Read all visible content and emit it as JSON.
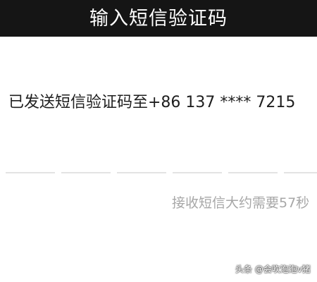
{
  "header": {
    "title": "输入短信验证码"
  },
  "main": {
    "sent_text": "已发送短信验证码至+86 137 **** 7215",
    "code_inputs": [
      {
        "value": ""
      },
      {
        "value": ""
      },
      {
        "value": ""
      },
      {
        "value": ""
      },
      {
        "value": ""
      },
      {
        "value": ""
      }
    ],
    "hint_text": "接收短信大约需要57秒"
  },
  "watermark": {
    "text": "头条 @会吹泡泡v猪"
  },
  "colors": {
    "header_background": "#151515",
    "header_text": "#ffffff",
    "body_text": "#1e1e1e",
    "hint_text": "#a7a7a7",
    "input_underline": "#e3e3e3"
  }
}
